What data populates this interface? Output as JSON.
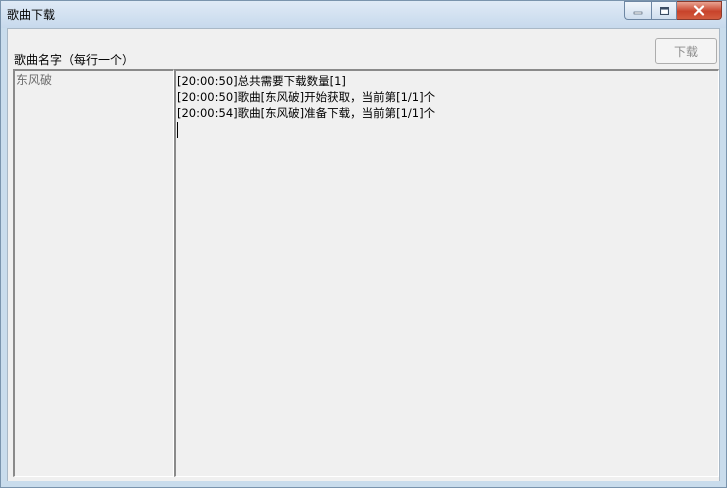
{
  "window": {
    "title": "歌曲下载",
    "controls": {
      "minimize": "minimize-icon",
      "maximize": "maximize-icon",
      "close": "close-icon"
    }
  },
  "form": {
    "list_label": "歌曲名字（每行一个）",
    "download_button": "下载",
    "songs": [
      "东风破"
    ],
    "log": [
      "[20:00:50]总共需要下载数量[1]",
      "[20:00:50]歌曲[东风破]开始获取，当前第[1/1]个",
      "[20:00:54]歌曲[东风破]准备下载，当前第[1/1]个"
    ]
  },
  "colors": {
    "title_bar": "#c7d9ec",
    "client_bg": "#f0f0f0",
    "close_button": "#c8432b",
    "disabled_text": "#8d8d8d"
  }
}
